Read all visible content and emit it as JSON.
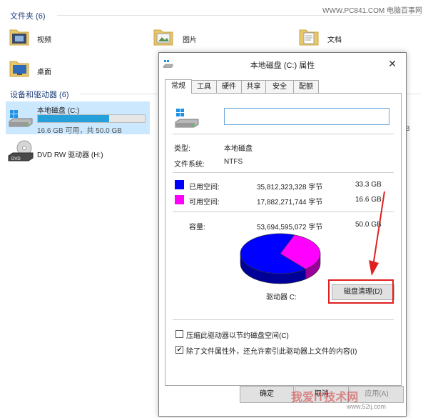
{
  "watermark": {
    "top": "WWW.PC841.COM 电脑百事网",
    "bottom": "我爱IT技术网",
    "url": "www.52ij.com"
  },
  "explorer": {
    "folders_header": "文件夹 (6)",
    "folders": [
      {
        "label": "视频",
        "icon": "video-folder-icon"
      },
      {
        "label": "图片",
        "icon": "pictures-folder-icon"
      },
      {
        "label": "文档",
        "icon": "documents-folder-icon"
      },
      {
        "label": "桌面",
        "icon": "desktop-folder-icon"
      }
    ],
    "drives_header": "设备和驱动器 (6)",
    "drives": [
      {
        "label": "本地磁盘 (C:)",
        "detail": "16.6 GB 可用，共 50.0 GB",
        "used_fraction": 0.668,
        "icon": "local-disk-icon"
      },
      {
        "label": "DVD RW 驱动器 (H:)",
        "icon": "dvd-drive-icon"
      }
    ],
    "partial_text": "B"
  },
  "dialog": {
    "title": "本地磁盘 (C:) 属性",
    "close_label": "✕",
    "tabs": [
      "常规",
      "工具",
      "硬件",
      "共享",
      "安全",
      "配额"
    ],
    "active_tab": 0,
    "name_value": "",
    "type_label": "类型:",
    "type_value": "本地磁盘",
    "fs_label": "文件系统:",
    "fs_value": "NTFS",
    "used": {
      "label": "已用空间:",
      "bytes": "35,812,323,328 字节",
      "size": "33.3 GB",
      "color": "#0000ff"
    },
    "free": {
      "label": "可用空间:",
      "bytes": "17,882,271,744 字节",
      "size": "16.6 GB",
      "color": "#ff00ff"
    },
    "capacity": {
      "label": "容量:",
      "bytes": "53,694,595,072 字节",
      "size": "50.0 GB"
    },
    "drive_label": "驱动器 C:",
    "cleanup_button": "磁盘清理(D)",
    "compress_label": "压缩此驱动器以节约磁盘空间(C)",
    "compress_checked": false,
    "index_label": "除了文件属性外，还允许索引此驱动器上文件的内容(I)",
    "index_checked": true,
    "ok_button": "确定",
    "cancel_button": "取消",
    "apply_button": "应用(A)",
    "check_mark": "✔",
    "annotation_color": "#e02020"
  },
  "chart_data": {
    "type": "pie",
    "categories": [
      "已用空间",
      "可用空间"
    ],
    "values": [
      33.3,
      16.6
    ],
    "colors": [
      "#0000ff",
      "#ff00ff"
    ]
  }
}
